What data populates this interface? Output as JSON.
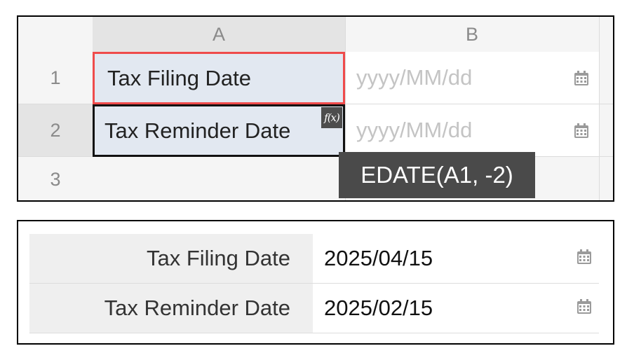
{
  "sheet": {
    "columns": [
      "A",
      "B"
    ],
    "rows": [
      "1",
      "2",
      "3"
    ],
    "cells": {
      "A1": "Tax Filing Date",
      "A2": "Tax Reminder Date",
      "B1_placeholder": "yyyy/MM/dd",
      "B2_placeholder": "yyyy/MM/dd"
    },
    "formula_badge": "f(x)",
    "formula_tooltip": "EDATE(A1, -2)"
  },
  "form": {
    "rows": [
      {
        "label": "Tax Filing Date",
        "value": "2025/04/15"
      },
      {
        "label": "Tax Reminder Date",
        "value": "2025/02/15"
      }
    ]
  },
  "icons": {
    "date_picker": "calendar-icon"
  },
  "colors": {
    "selected_cell_border": "#ef4b4b",
    "active_cell_border": "#111111",
    "cell_fill": "#e2e8f1",
    "tooltip_bg": "#4a4a4a"
  }
}
